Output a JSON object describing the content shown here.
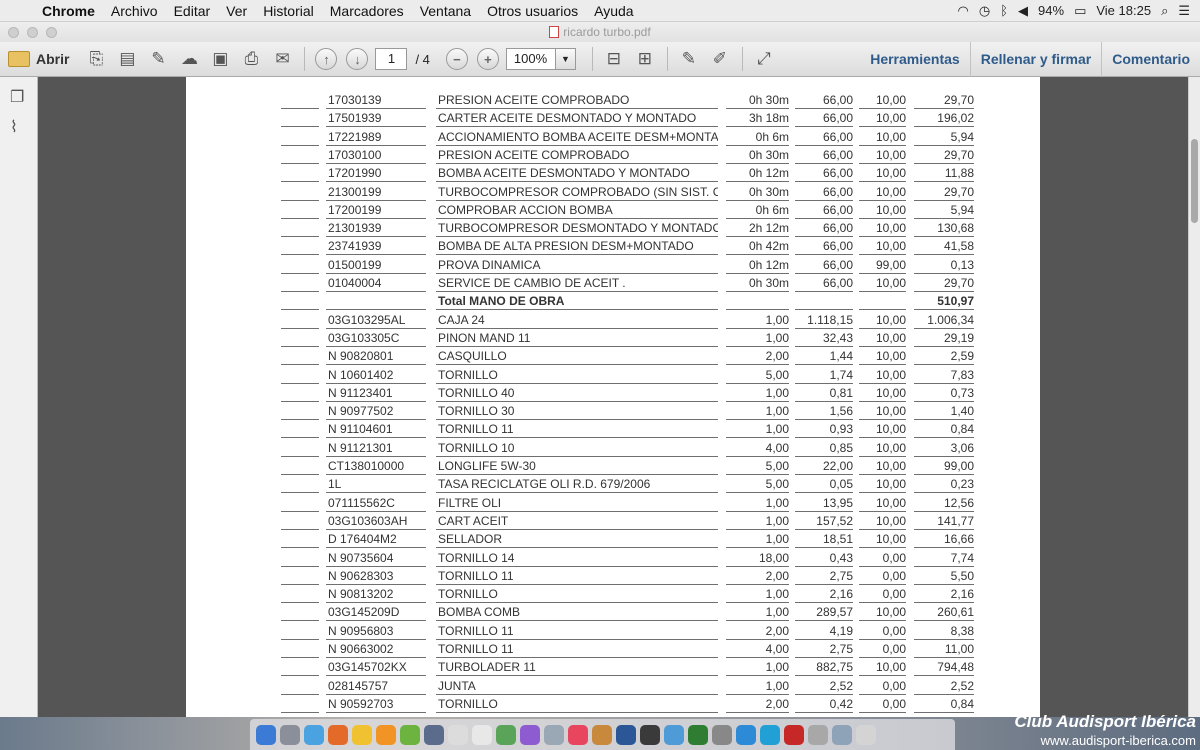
{
  "menubar": {
    "app": "Chrome",
    "items": [
      "Archivo",
      "Editar",
      "Ver",
      "Historial",
      "Marcadores",
      "Ventana",
      "Otros usuarios",
      "Ayuda"
    ],
    "battery": "94%",
    "clock": "Vie 18:25"
  },
  "window": {
    "title": "ricardo turbo.pdf"
  },
  "toolbar": {
    "open_label": "Abrir",
    "page_current": "1",
    "page_total": "/ 4",
    "zoom": "100%",
    "tools_label": "Herramientas",
    "fill_sign_label": "Rellenar y firmar",
    "comment_label": "Comentario"
  },
  "table": {
    "rows": [
      {
        "code": "17030139",
        "desc": "PRESION ACEITE COMPROBADO",
        "qty": "0h 30m",
        "price": "66,00",
        "pct": "10,00",
        "total": "29,70"
      },
      {
        "code": "17501939",
        "desc": "CARTER ACEITE DESMONTADO Y MONTADO",
        "qty": "3h 18m",
        "price": "66,00",
        "pct": "10,00",
        "total": "196,02"
      },
      {
        "code": "17221989",
        "desc": "ACCIONAMIENTO BOMBA ACEITE DESM+MONTADO",
        "qty": "0h 6m",
        "price": "66,00",
        "pct": "10,00",
        "total": "5,94"
      },
      {
        "code": "17030100",
        "desc": "PRESION ACEITE COMPROBADO",
        "qty": "0h 30m",
        "price": "66,00",
        "pct": "10,00",
        "total": "29,70"
      },
      {
        "code": "17201990",
        "desc": "BOMBA ACEITE DESMONTADO Y MONTADO",
        "qty": "0h 12m",
        "price": "66,00",
        "pct": "10,00",
        "total": "11,88"
      },
      {
        "code": "21300199",
        "desc": "TURBOCOMPRESOR COMPROBADO (SIN SIST. CAR",
        "qty": "0h 30m",
        "price": "66,00",
        "pct": "10,00",
        "total": "29,70"
      },
      {
        "code": "17200199",
        "desc": "COMPROBAR ACCION BOMBA",
        "qty": "0h 6m",
        "price": "66,00",
        "pct": "10,00",
        "total": "5,94"
      },
      {
        "code": "21301939",
        "desc": "TURBOCOMPRESOR DESMONTADO Y MONTADO",
        "qty": "2h 12m",
        "price": "66,00",
        "pct": "10,00",
        "total": "130,68"
      },
      {
        "code": "23741939",
        "desc": "BOMBA DE ALTA PRESION DESM+MONTADO",
        "qty": "0h 42m",
        "price": "66,00",
        "pct": "10,00",
        "total": "41,58"
      },
      {
        "code": "01500199",
        "desc": "PROVA DINAMICA",
        "qty": "0h 12m",
        "price": "66,00",
        "pct": "99,00",
        "total": "0,13"
      },
      {
        "code": "01040004",
        "desc": "SERVICE DE CAMBIO DE ACEIT .",
        "qty": "0h 30m",
        "price": "66,00",
        "pct": "10,00",
        "total": "29,70"
      },
      {
        "code": "",
        "desc": "Total MANO DE OBRA",
        "qty": "",
        "price": "",
        "pct": "",
        "total": "510,97",
        "bold": true
      },
      {
        "code": "03G103295AL",
        "desc": "CAJA 24",
        "qty": "1,00",
        "price": "1.118,15",
        "pct": "10,00",
        "total": "1.006,34"
      },
      {
        "code": "03G103305C",
        "desc": "PINON MAND 11",
        "qty": "1,00",
        "price": "32,43",
        "pct": "10,00",
        "total": "29,19"
      },
      {
        "code": "N 90820801",
        "desc": "CASQUILLO",
        "qty": "2,00",
        "price": "1,44",
        "pct": "10,00",
        "total": "2,59"
      },
      {
        "code": "N 10601402",
        "desc": "TORNILLO",
        "qty": "5,00",
        "price": "1,74",
        "pct": "10,00",
        "total": "7,83"
      },
      {
        "code": "N 91123401",
        "desc": "TORNILLO 40",
        "qty": "1,00",
        "price": "0,81",
        "pct": "10,00",
        "total": "0,73"
      },
      {
        "code": "N 90977502",
        "desc": "TORNILLO 30",
        "qty": "1,00",
        "price": "1,56",
        "pct": "10,00",
        "total": "1,40"
      },
      {
        "code": "N 91104601",
        "desc": "TORNILLO 11",
        "qty": "1,00",
        "price": "0,93",
        "pct": "10,00",
        "total": "0,84"
      },
      {
        "code": "N 91121301",
        "desc": "TORNILLO 10",
        "qty": "4,00",
        "price": "0,85",
        "pct": "10,00",
        "total": "3,06"
      },
      {
        "code": "CT138010000",
        "desc": "LONGLIFE  5W-30",
        "qty": "5,00",
        "price": "22,00",
        "pct": "10,00",
        "total": "99,00"
      },
      {
        "code": "1L",
        "desc": "TASA RECICLATGE OLI R.D. 679/2006",
        "qty": "5,00",
        "price": "0,05",
        "pct": "10,00",
        "total": "0,23"
      },
      {
        "code": "071115562C",
        "desc": "FILTRE OLI",
        "qty": "1,00",
        "price": "13,95",
        "pct": "10,00",
        "total": "12,56"
      },
      {
        "code": "03G103603AH",
        "desc": "CART ACEIT",
        "qty": "1,00",
        "price": "157,52",
        "pct": "10,00",
        "total": "141,77"
      },
      {
        "code": "D 176404M2",
        "desc": "SELLADOR",
        "qty": "1,00",
        "price": "18,51",
        "pct": "10,00",
        "total": "16,66"
      },
      {
        "code": "N 90735604",
        "desc": "TORNILLO 14",
        "qty": "18,00",
        "price": "0,43",
        "pct": "0,00",
        "total": "7,74"
      },
      {
        "code": "N 90628303",
        "desc": "TORNILLO 11",
        "qty": "2,00",
        "price": "2,75",
        "pct": "0,00",
        "total": "5,50"
      },
      {
        "code": "N 90813202",
        "desc": "TORNILLO",
        "qty": "1,00",
        "price": "2,16",
        "pct": "0,00",
        "total": "2,16"
      },
      {
        "code": "03G145209D",
        "desc": "BOMBA COMB",
        "qty": "1,00",
        "price": "289,57",
        "pct": "10,00",
        "total": "260,61"
      },
      {
        "code": "N 90956803",
        "desc": "TORNILLO 11",
        "qty": "2,00",
        "price": "4,19",
        "pct": "0,00",
        "total": "8,38"
      },
      {
        "code": "N 90663002",
        "desc": "TORNILLO 11",
        "qty": "4,00",
        "price": "2,75",
        "pct": "0,00",
        "total": "11,00"
      },
      {
        "code": "03G145702KX",
        "desc": "TURBOLADER 11",
        "qty": "1,00",
        "price": "882,75",
        "pct": "10,00",
        "total": "794,48"
      },
      {
        "code": "028145757",
        "desc": "JUNTA",
        "qty": "1,00",
        "price": "2,52",
        "pct": "0,00",
        "total": "2,52"
      },
      {
        "code": "N 90592703",
        "desc": "TORNILLO",
        "qty": "2,00",
        "price": "0,42",
        "pct": "0,00",
        "total": "0,84"
      }
    ]
  },
  "watermark": {
    "line1": "Club Audisport Ibérica",
    "line2": "www.audisport-iberica.com"
  },
  "colors": {
    "link": "#2f5b8a",
    "doc_background": "#555555"
  }
}
